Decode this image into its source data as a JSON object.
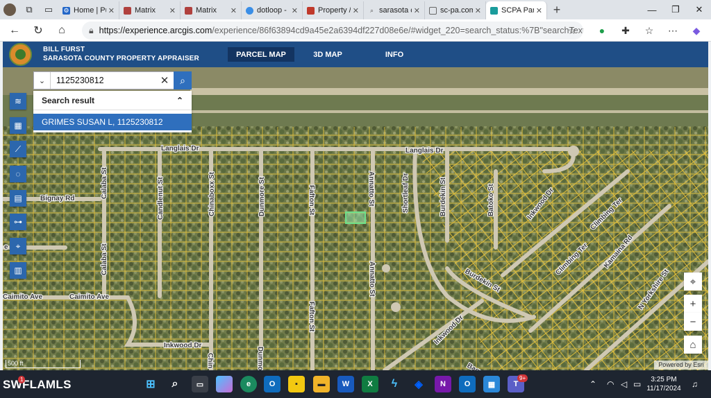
{
  "browser": {
    "tabs": [
      {
        "label": "Home | Pu",
        "icon": "settings-icon",
        "color": "#2266c8"
      },
      {
        "label": "Matrix",
        "icon": "matrix-icon",
        "color": "#b0413e"
      },
      {
        "label": "Matrix",
        "icon": "matrix-icon",
        "color": "#b0413e"
      },
      {
        "label": "dotloop - ",
        "icon": "dotloop-icon",
        "color": "#3a8ee6"
      },
      {
        "label": "Property /",
        "icon": "pdf-icon",
        "color": "#c0392b"
      },
      {
        "label": "sarasota c",
        "icon": "search-icon",
        "color": "#555555"
      },
      {
        "label": "sc-pa.com",
        "icon": "page-icon",
        "color": "#666666"
      },
      {
        "label": "SCPA Parc",
        "icon": "arcgis-icon",
        "color": "#1a9c9c"
      }
    ],
    "url_domain": "https://experience.arcgis.com",
    "url_rest": "/experience/86f63894cd9a45e2a6394df227d08e6e/#widget_220=search_status:%7B\"searchText\"%3..."
  },
  "app": {
    "org_line1": "BILL FURST",
    "org_line2": "SARASOTA COUNTY PROPERTY APPRAISER",
    "nav": [
      "PARCEL MAP",
      "3D MAP",
      "INFO"
    ],
    "accent": "#1f4e86"
  },
  "search": {
    "value": "1125230812",
    "result_header": "Search result",
    "result_item": "GRIMES SUSAN L, 1125230812"
  },
  "map": {
    "scale_label": "500 ft",
    "attribution": "Powered by Esri",
    "streets": [
      "Langlais Dr",
      "Langlais Dr",
      "Bignay Rd",
      "Calaba St",
      "Calaba St",
      "Candlenut St",
      "Chinaboxx St",
      "Dunmore St",
      "Fafton St",
      "Fafton St",
      "Annatto St",
      "Annatto St",
      "Shortleaf Dr",
      "Burdekin St",
      "Batoko St",
      "Inkwood Dr",
      "Climbing Ter",
      "Climbing Ter",
      "Kamaina Rd",
      "N Yorkshire St",
      "Burdekin St",
      "Inkwood Dr",
      "Inkwood Dr",
      "Caimito Ave",
      "Caimito Ave",
      "Dunmore",
      "Chin",
      "Baor",
      "e"
    ]
  },
  "taskbar": {
    "brand": "SWFLAMLS",
    "time": "3:25 PM",
    "date": "11/17/2024",
    "notif_badge": "1",
    "teams_badge": "9+"
  }
}
